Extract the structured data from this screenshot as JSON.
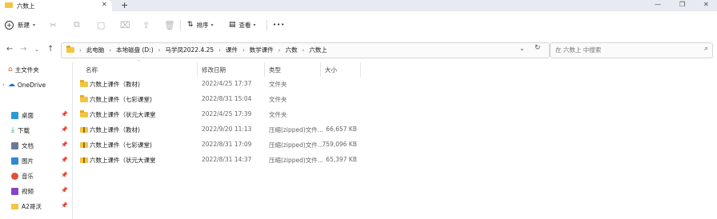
{
  "window": {
    "tab_title": "六数上",
    "close_tab": "✕",
    "new_tab": "+",
    "minimize": "—",
    "maximize": "❐",
    "close": "✕"
  },
  "toolbar": {
    "new_label": "新建",
    "sort_label": "排序",
    "view_label": "查看",
    "more": "•••"
  },
  "address": {
    "breadcrumbs": [
      "此电脑",
      "本地磁盘 (D:)",
      "马学凤2022.4.25",
      "课件",
      "数学课件",
      "六数",
      "六数上"
    ],
    "search_placeholder": "在 六数上 中搜索"
  },
  "sidebar": {
    "items": [
      {
        "label": "主文件夹",
        "icon": "home-icon",
        "color": "#e05a2b"
      },
      {
        "label": "OneDrive",
        "icon": "cloud-icon",
        "color": "#1e6fd9"
      },
      {
        "label": "桌面",
        "icon": "desktop-icon",
        "color": "#2b9bd8"
      },
      {
        "label": "下载",
        "icon": "download-icon",
        "color": "#1f9a57"
      },
      {
        "label": "文档",
        "icon": "document-icon",
        "color": "#6b7a99"
      },
      {
        "label": "图片",
        "icon": "pictures-icon",
        "color": "#2f87d6"
      },
      {
        "label": "音乐",
        "icon": "music-icon",
        "color": "#e0503a"
      },
      {
        "label": "视频",
        "icon": "video-icon",
        "color": "#8247c7"
      },
      {
        "label": "A2哥沃",
        "icon": "folder-icon",
        "color": "#f4c542"
      }
    ]
  },
  "columns": {
    "name": "名称",
    "modified": "修改日期",
    "type": "类型",
    "size": "大小"
  },
  "files": [
    {
      "name": "六数上课件（教材)",
      "modified": "2022/4/25 17:37",
      "type": "文件夹",
      "size": "",
      "icon": "folder-icon"
    },
    {
      "name": "六数上课件（七彩课堂)",
      "modified": "2022/8/31 15:04",
      "type": "文件夹",
      "size": "",
      "icon": "folder-icon"
    },
    {
      "name": "六数上课件（状元大课堂",
      "modified": "2022/4/25 17:39",
      "type": "文件夹",
      "size": "",
      "icon": "folder-icon"
    },
    {
      "name": "六数上课件（教材)",
      "modified": "2022/9/20 11:13",
      "type": "压缩(zipped)文件...",
      "size": "66,657 KB",
      "icon": "zip-folder-icon"
    },
    {
      "name": "六数上课件（七彩课堂)",
      "modified": "2022/8/31 17:09",
      "type": "压缩(zipped)文件...",
      "size": "759,096 KB",
      "icon": "zip-folder-icon"
    },
    {
      "name": "六数上课件（状元大课堂",
      "modified": "2022/8/31 14:37",
      "type": "压缩(zipped)文件...",
      "size": "65,397 KB",
      "icon": "zip-folder-icon"
    }
  ]
}
